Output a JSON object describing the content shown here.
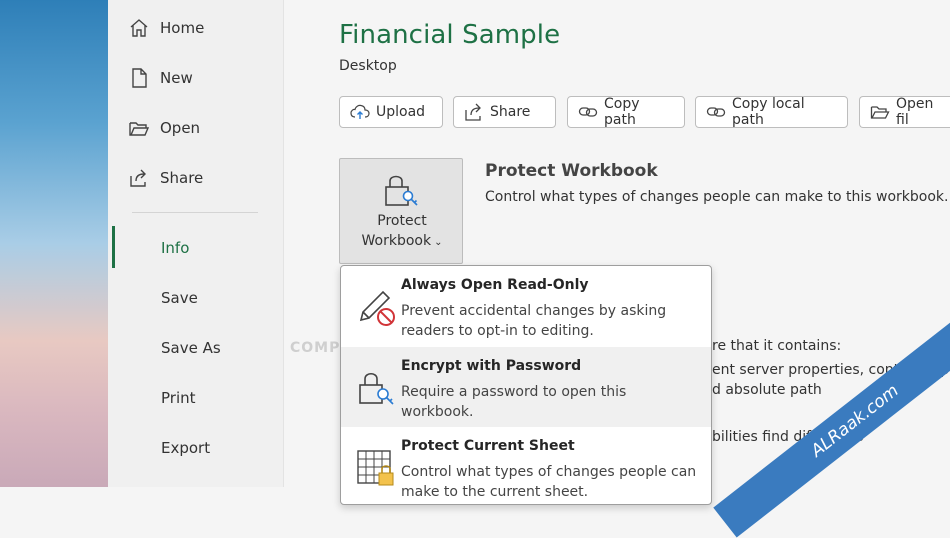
{
  "sidebar": {
    "items": [
      {
        "label": "Home"
      },
      {
        "label": "New"
      },
      {
        "label": "Open"
      },
      {
        "label": "Share"
      },
      {
        "label": "Info"
      },
      {
        "label": "Save"
      },
      {
        "label": "Save As"
      },
      {
        "label": "Print"
      },
      {
        "label": "Export"
      }
    ],
    "active_color": "#1e7145"
  },
  "header": {
    "title": "Financial Sample",
    "subtitle": "Desktop"
  },
  "toolbar": {
    "upload": "Upload",
    "share": "Share",
    "copy_path": "Copy path",
    "copy_local_path": "Copy local path",
    "open_file_location": "Open fil"
  },
  "protect": {
    "button_line1": "Protect",
    "button_line2": "Workbook",
    "title": "Protect Workbook",
    "description": "Control what types of changes people can make to this workbook."
  },
  "background_text": {
    "line1": "re that it contains:",
    "line2": "ent server properties, content typ",
    "line3": "d absolute path",
    "line4": "bilities find difficult to"
  },
  "watermark": {
    "middle": "COMPUTERWO.COM",
    "ribbon": "ALRaak.com"
  },
  "menu": {
    "items": [
      {
        "title": "Always Open Read-Only",
        "description": "Prevent accidental changes by asking readers to opt-in to editing.",
        "icon": "pencil-no-icon"
      },
      {
        "title": "Encrypt with Password",
        "description": "Require a password to open this workbook.",
        "icon": "lock-key-icon"
      },
      {
        "title": "Protect Current Sheet",
        "description": "Control what types of changes people can make to the current sheet.",
        "icon": "sheet-lock-icon"
      }
    ]
  }
}
